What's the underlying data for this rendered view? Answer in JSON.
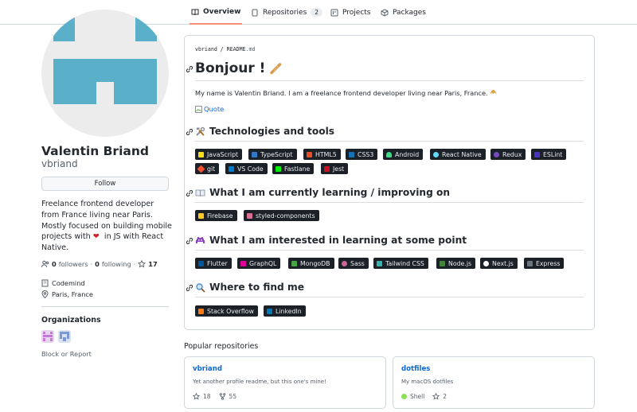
{
  "nav": {
    "tabs": [
      {
        "label": "Overview",
        "icon": "book-icon",
        "active": true
      },
      {
        "label": "Repositories",
        "icon": "repo-icon",
        "count": "2"
      },
      {
        "label": "Projects",
        "icon": "project-icon"
      },
      {
        "label": "Packages",
        "icon": "package-icon"
      }
    ]
  },
  "profile": {
    "name": "Valentin Briand",
    "login": "vbriand",
    "follow_label": "Follow",
    "bio_line1": "Freelance frontend developer",
    "bio_line2": "from France living near Paris.",
    "bio_line3": "Mostly focused on building mobile",
    "bio_line4a": "projects with",
    "bio_heart": "❤",
    "bio_line4b": "in JS with React",
    "bio_line5": "Native.",
    "followers_count": "0",
    "followers_label": "followers",
    "following_count": "0",
    "following_label": "following",
    "stars_count": "17",
    "company": "Codemind",
    "location": "Paris, France",
    "orgs_title": "Organizations",
    "block_label": "Block or Report"
  },
  "readme": {
    "crumb_user": "vbriand",
    "crumb_sep": "/",
    "crumb_file": "README",
    "crumb_ext": ".md",
    "title": "Bonjour !",
    "intro": "My name is Valentin Briand. I am a freelance frontend developer living near Paris, France.",
    "quote_alt": "Quote",
    "sections": {
      "tech": "Technologies and tools",
      "learning": "What I am currently learning / improving on",
      "interested": "What I am interested in learning at some point",
      "find": "Where to find me"
    },
    "tech_badges": [
      "JavaScript",
      "TypeScript",
      "HTML5",
      "CSS3",
      "Android",
      "React Native",
      "Redux",
      "ESLint",
      "git",
      "VS Code",
      "Fastlane",
      "Jest"
    ],
    "learning_badges": [
      "Firebase",
      "styled-components"
    ],
    "interested_badges": [
      "Flutter",
      "GraphQL",
      "MongoDB",
      "Sass",
      "Tailwind CSS",
      "Node.js",
      "Next.js",
      "Express"
    ],
    "find_badges": [
      "Stack Overflow",
      "LinkedIn"
    ]
  },
  "popular": {
    "title": "Popular repositories",
    "repos": [
      {
        "name": "vbriand",
        "desc": "Yet another profile readme, but this one's mine!",
        "stars": "18",
        "forks": "55"
      },
      {
        "name": "dotfiles",
        "desc": "My macOS dotfiles",
        "lang": "Shell",
        "stars": "2"
      }
    ]
  },
  "colors": {
    "accent_tab": "#fd8c73",
    "link": "#0969da",
    "badge_bg": "#1c2127",
    "avatar_tile": "#5ab0c8",
    "shell_lang": "#89e051"
  }
}
